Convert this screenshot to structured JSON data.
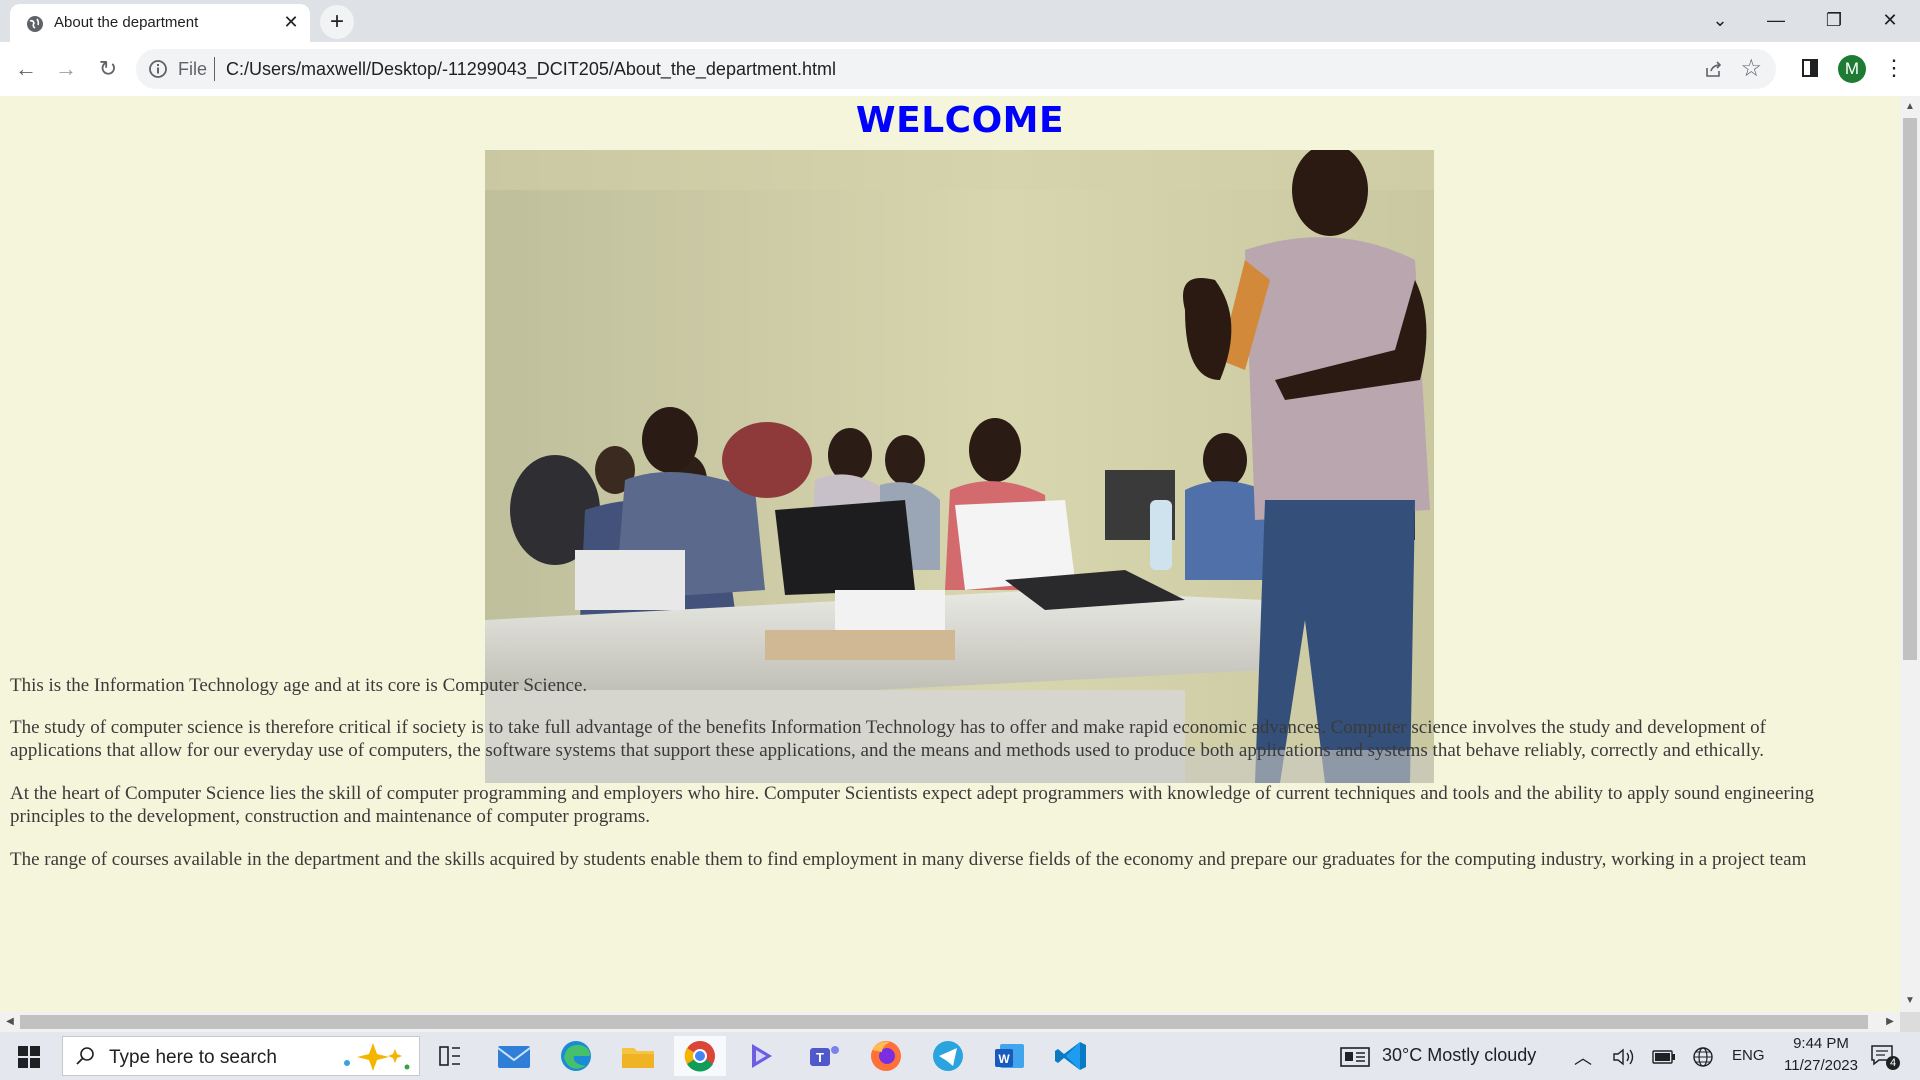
{
  "browser": {
    "tab_title": "About the department",
    "tab_close": "✕",
    "new_tab": "+",
    "scheme_label": "File",
    "url": "C:/Users/maxwell/Desktop/-11299043_DCIT205/About_the_department.html",
    "profile_initial": "M"
  },
  "page": {
    "heading": "WELCOME",
    "paragraphs": [
      "This is the Information Technology age and at its core is Computer Science.",
      "The study of computer science is therefore critical if society is to take full advantage of the benefits Information Technology has to offer and make rapid economic advances. Computer science involves the study and development of",
      "applications that allow for our everyday use of computers, the software systems that support these applications, and the means and methods used to produce both applications and systems that behave reliably, correctly and ethically.",
      "At the heart of Computer Science lies the skill of computer programming and employers who hire. Computer Scientists expect adept programmers with knowledge of current techniques and tools and the ability to apply sound engineering",
      "principles to the development, construction and maintenance of computer programs.",
      "The range of courses available in the department and the skills acquired by students enable them to find employment in many diverse fields of the economy and prepare our graduates for the computing industry, working in a project team"
    ],
    "photo_icon": "classroom-lecture-photo"
  },
  "taskbar": {
    "search_placeholder": "Type here to search",
    "weather": "30°C  Mostly cloudy",
    "language": "ENG",
    "time": "9:44 PM",
    "date": "11/27/2023",
    "notification_count": "4",
    "apps": [
      "task-view",
      "mail",
      "edge",
      "file-explorer",
      "chrome",
      "copilot",
      "teams",
      "firefox",
      "telegram",
      "word",
      "vscode"
    ]
  }
}
